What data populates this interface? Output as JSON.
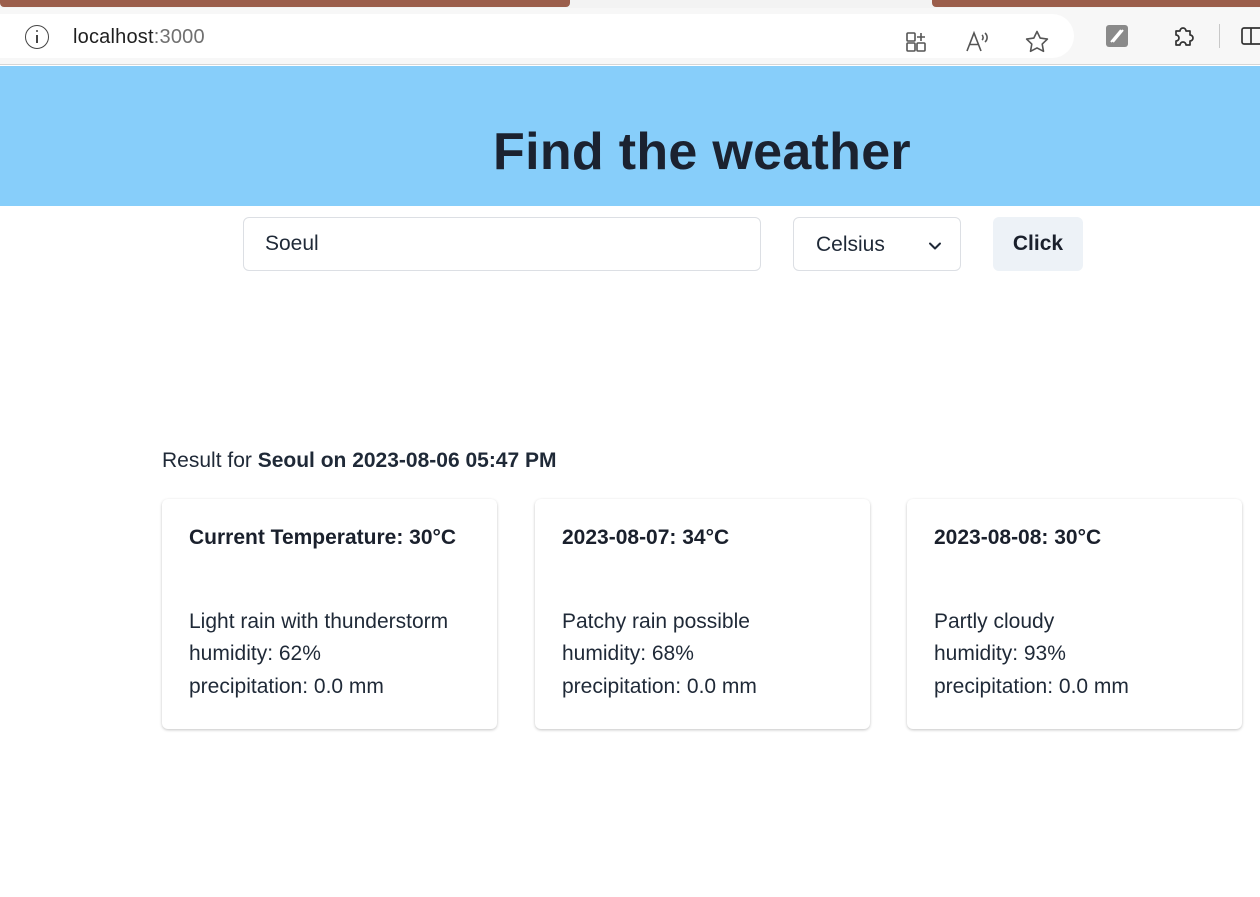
{
  "browser": {
    "url_host": "localhost",
    "url_port": ":3000"
  },
  "page": {
    "title": "Find the weather",
    "search": {
      "value": "Soeul"
    },
    "unit_select": {
      "selected": "Celsius"
    },
    "submit_label": "Click",
    "result": {
      "prefix": "Result for ",
      "location_time": "Seoul on 2023-08-06 05:47 PM"
    },
    "cards": [
      {
        "heading": "Current Temperature: 30°C",
        "description": "Light rain with thunderstorm",
        "humidity": "humidity: 62%",
        "precipitation": "precipitation: 0.0 mm"
      },
      {
        "heading": "2023-08-07: 34°C",
        "description": "Patchy rain possible",
        "humidity": "humidity: 68%",
        "precipitation": "precipitation: 0.0 mm"
      },
      {
        "heading": "2023-08-08: 30°C",
        "description": "Partly cloudy",
        "humidity": "humidity: 93%",
        "precipitation": "precipitation: 0.0 mm"
      }
    ]
  },
  "colors": {
    "hero_background": "#87cefa",
    "text_dark": "#1b2230",
    "button_background": "#edf2f7"
  }
}
